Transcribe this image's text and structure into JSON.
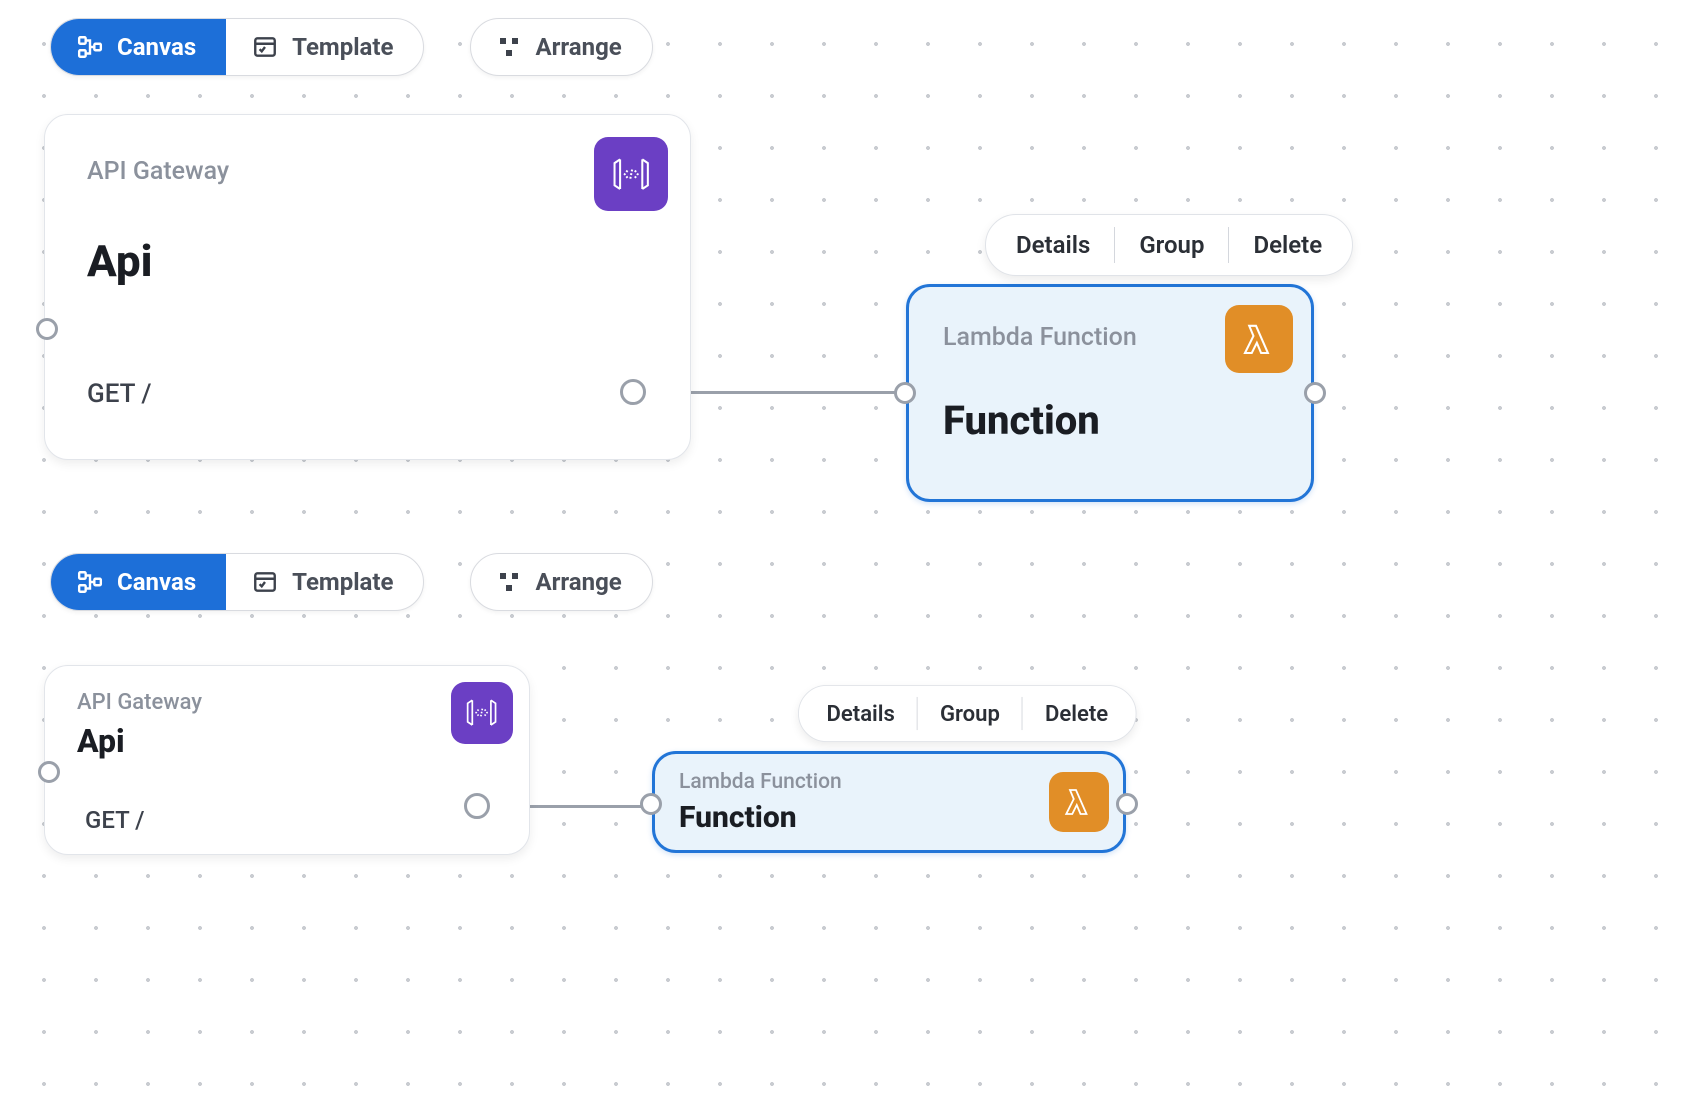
{
  "colors": {
    "accent": "#1d6fd8",
    "apigw": "#6b3fc4",
    "lambda": "#e18e27",
    "selected_border": "#2275d7"
  },
  "toolbar": {
    "canvas": {
      "label": "Canvas",
      "icon": "flow-icon",
      "active": true
    },
    "template": {
      "label": "Template",
      "icon": "template-icon",
      "active": false
    },
    "arrange": {
      "label": "Arrange",
      "icon": "arrange-icon"
    }
  },
  "context_menu": {
    "details": "Details",
    "group": "Group",
    "delete": "Delete"
  },
  "panels": [
    {
      "api_card": {
        "service": "API Gateway",
        "title": "Api",
        "endpoint": "GET /",
        "icon": "apigateway-icon"
      },
      "fn_card": {
        "service": "Lambda Function",
        "title": "Function",
        "icon": "lambda-icon",
        "selected": true
      }
    },
    {
      "api_card": {
        "service": "API Gateway",
        "title": "Api",
        "endpoint": "GET /",
        "icon": "apigateway-icon"
      },
      "fn_card": {
        "service": "Lambda Function",
        "title": "Function",
        "icon": "lambda-icon",
        "selected": true
      }
    }
  ]
}
